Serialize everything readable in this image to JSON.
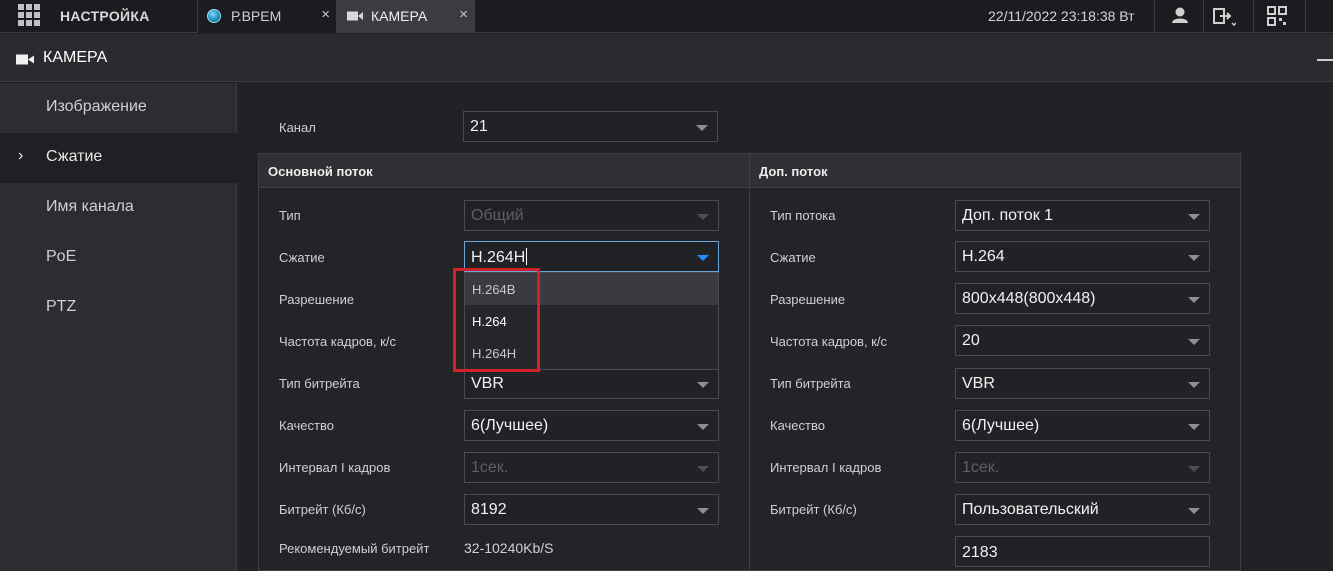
{
  "topbar": {
    "app_title": "НАСТРОЙКА",
    "tabs": [
      {
        "label": "Р.ВРЕМ",
        "close": "×"
      },
      {
        "label": "КАМЕРА",
        "close": "×"
      }
    ],
    "datetime": "22/11/2022 23:18:38 Вт"
  },
  "page": {
    "title": "КАМЕРА"
  },
  "sidebar": {
    "items": [
      {
        "label": "Изображение"
      },
      {
        "label": "Сжатие",
        "marker": "›"
      },
      {
        "label": "Имя канала"
      },
      {
        "label": "PoE"
      },
      {
        "label": "PTZ"
      }
    ]
  },
  "channel": {
    "label": "Канал",
    "value": "21"
  },
  "main_stream": {
    "title": "Основной поток",
    "type_label": "Тип",
    "type_value": "Общий",
    "compression_label": "Сжатие",
    "compression_value": "H.264H",
    "resolution_label": "Разрешение",
    "fps_label": "Частота кадров, к/с",
    "bitrate_type_label": "Тип битрейта",
    "bitrate_type_value": "VBR",
    "quality_label": "Качество",
    "quality_value": "6(Лучшее)",
    "iframe_label": "Интервал I кадров",
    "iframe_value": "1сек.",
    "bitrate_label": "Битрейт (Кб/с)",
    "bitrate_value": "8192",
    "recommended_label": "Рекомендуемый битрейт",
    "recommended_value": "32-10240Kb/S"
  },
  "compression_dropdown": {
    "options": [
      "H.264B",
      "H.264",
      "H.264H"
    ]
  },
  "sub_stream": {
    "title": "Доп. поток",
    "stream_type_label": "Тип потока",
    "stream_type_value": "Доп. поток 1",
    "compression_label": "Сжатие",
    "compression_value": "H.264",
    "resolution_label": "Разрешение",
    "resolution_value": "800x448(800x448)",
    "fps_label": "Частота кадров, к/с",
    "fps_value": "20",
    "bitrate_type_label": "Тип битрейта",
    "bitrate_type_value": "VBR",
    "quality_label": "Качество",
    "quality_value": "6(Лучшее)",
    "iframe_label": "Интервал I кадров",
    "iframe_value": "1сек.",
    "bitrate_label": "Битрейт (Кб/с)",
    "bitrate_value": "Пользовательский",
    "custom_bitrate_value": "2183"
  },
  "colors": {
    "background": "#212226",
    "highlight_box": "#d3202a",
    "focus_caret": "#1e90ff"
  }
}
